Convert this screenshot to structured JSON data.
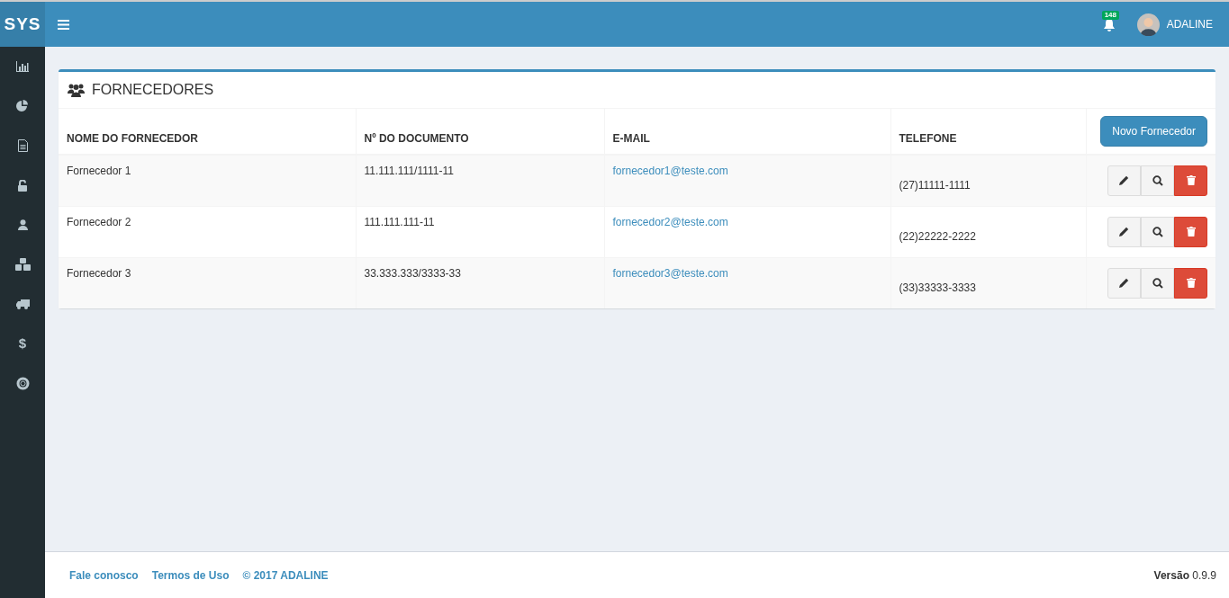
{
  "brand": "SYS",
  "sidebar": {
    "items": [
      {
        "kind": "icon"
      },
      {
        "kind": "icon"
      },
      {
        "kind": "icon"
      },
      {
        "kind": "icon"
      },
      {
        "kind": "icon"
      },
      {
        "kind": "icon"
      },
      {
        "kind": "icon"
      },
      {
        "kind": "glyph",
        "text": "$"
      },
      {
        "kind": "icon"
      }
    ]
  },
  "header": {
    "notifications": "148",
    "user": "ADALINE"
  },
  "panel": {
    "title": "FORNECEDORES",
    "new_button": "Novo Fornecedor",
    "columns": [
      "NOME DO FORNECEDOR",
      "Nº DO DOCUMENTO",
      "E-MAIL",
      "TELEFONE"
    ],
    "rows": [
      {
        "name": "Fornecedor 1",
        "document": "11.111.111/1111-11",
        "email": "fornecedor1@teste.com",
        "phone": "(27)11111-1111"
      },
      {
        "name": "Fornecedor 2",
        "document": "111.111.111-11",
        "email": "fornecedor2@teste.com",
        "phone": "(22)22222-2222"
      },
      {
        "name": "Fornecedor 3",
        "document": "33.333.333/3333-33",
        "email": "fornecedor3@teste.com",
        "phone": "(33)33333-3333"
      }
    ]
  },
  "footer": {
    "links": [
      "Fale conosco",
      "Termos de Uso",
      "© 2017 ADALINE"
    ],
    "version": "**Versão** 0.9.9"
  }
}
